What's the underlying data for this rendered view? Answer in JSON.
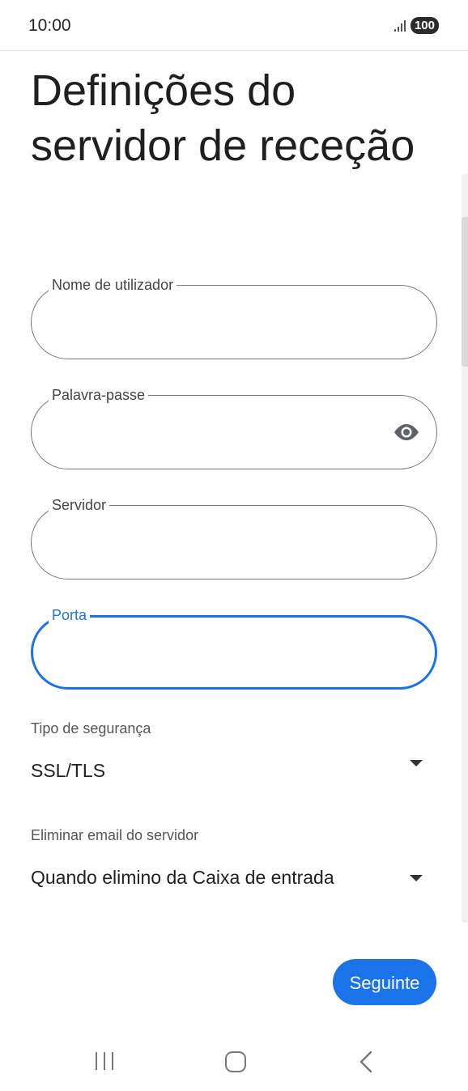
{
  "status": {
    "time": "10:00",
    "battery": "100",
    "signal_icon": "signal-icon"
  },
  "title": "Definições do servidor de receção",
  "fields": {
    "username": {
      "label": "Nome de utilizador",
      "value": ""
    },
    "password": {
      "label": "Palavra-passe",
      "value": "",
      "icon": "eye-icon"
    },
    "server": {
      "label": "Servidor",
      "value": ""
    },
    "port": {
      "label": "Porta",
      "value": "",
      "focused": true
    }
  },
  "security": {
    "label": "Tipo de segurança",
    "value": "SSL/TLS"
  },
  "delete_email": {
    "label": "Eliminar email do servidor",
    "value": "Quando elimino da Caixa de entrada"
  },
  "next_button": "Seguinte",
  "colors": {
    "accent": "#1a73e8",
    "outline": "#777777"
  }
}
